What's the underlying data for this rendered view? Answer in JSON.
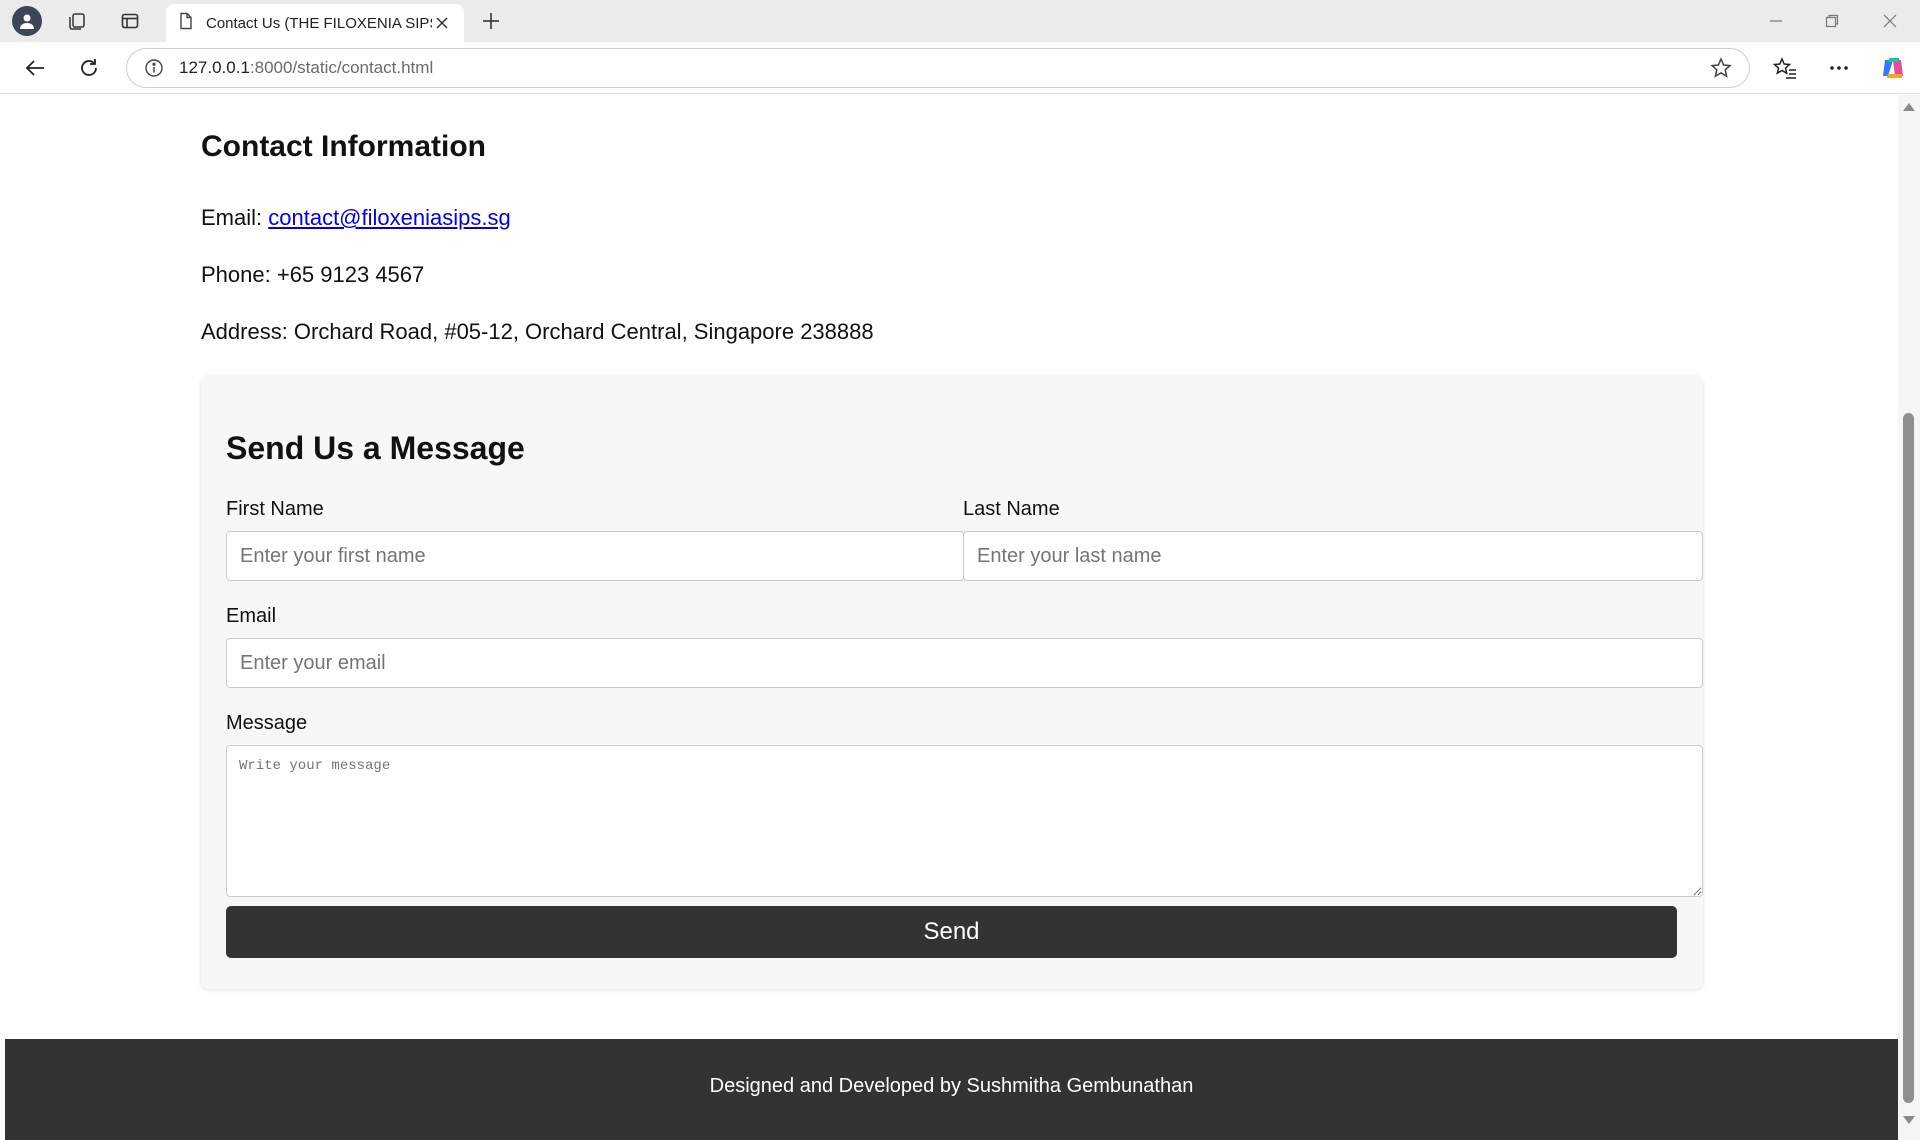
{
  "browser": {
    "tab_title": "Contact Us (THE FILOXENIA SIPS)",
    "url_host": "127.0.0.1",
    "url_rest": ":8000/static/contact.html"
  },
  "contact": {
    "title": "Contact Information",
    "email_label": "Email: ",
    "email": "contact@filoxeniasips.sg",
    "phone": "Phone: +65 9123 4567",
    "address": "Address: Orchard Road, #05-12, Orchard Central, Singapore 238888"
  },
  "form": {
    "title": "Send Us a Message",
    "first_name_label": "First Name",
    "first_name_placeholder": "Enter your first name",
    "last_name_label": "Last Name",
    "last_name_placeholder": "Enter your last name",
    "email_label": "Email",
    "email_placeholder": "Enter your email",
    "message_label": "Message",
    "message_placeholder": "Write your message",
    "send_label": "Send"
  },
  "footer": {
    "text": "Designed and Developed by Sushmitha Gembunathan"
  },
  "colors": {
    "dark": "#333333",
    "link": "#0000ee",
    "card": "#f7f7f7"
  }
}
